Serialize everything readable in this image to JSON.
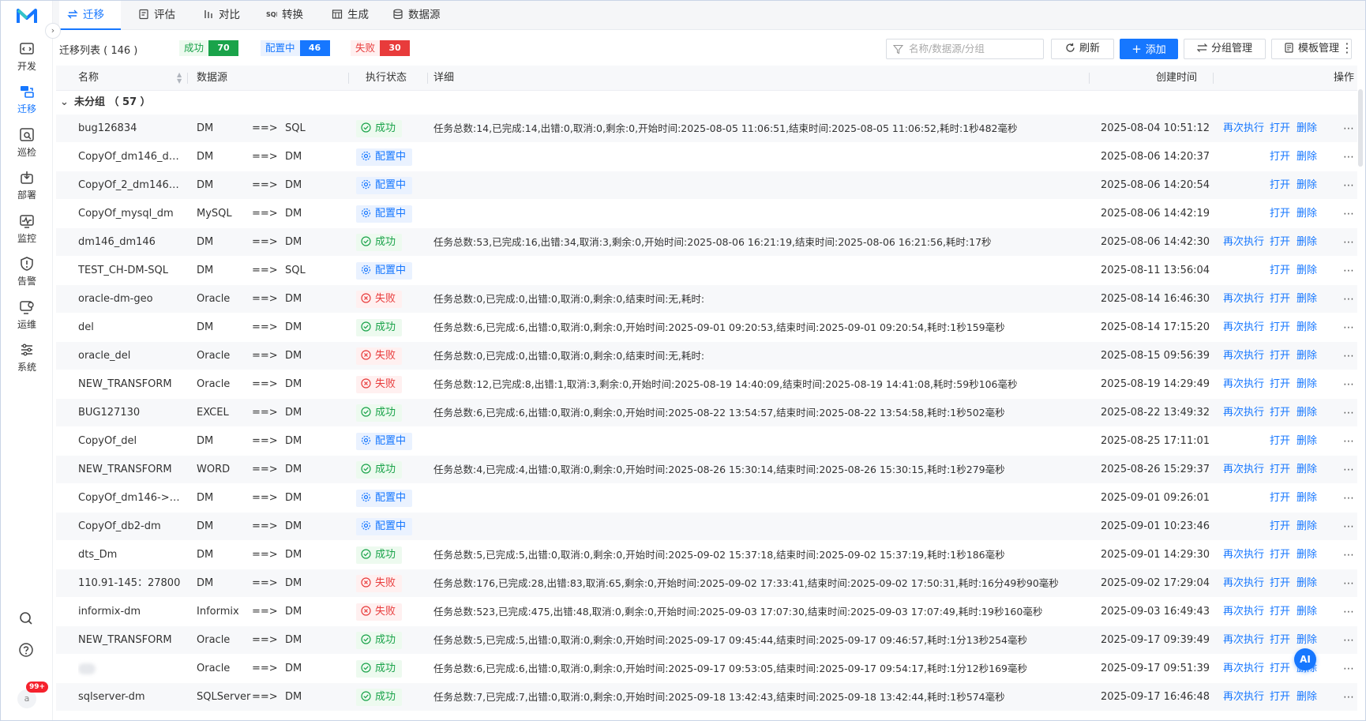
{
  "sidebar": {
    "items": [
      {
        "label": "开发",
        "icon": "code-icon"
      },
      {
        "label": "迁移",
        "icon": "migrate-icon"
      },
      {
        "label": "巡检",
        "icon": "inspect-icon"
      },
      {
        "label": "部署",
        "icon": "deploy-icon"
      },
      {
        "label": "监控",
        "icon": "monitor-icon"
      },
      {
        "label": "告警",
        "icon": "alert-icon"
      },
      {
        "label": "运维",
        "icon": "ops-icon"
      },
      {
        "label": "系统",
        "icon": "settings-icon"
      }
    ],
    "active_index": 1,
    "notification_count": "99+",
    "avatar_text": "a"
  },
  "tabs": [
    {
      "label": "迁移",
      "icon": "migrate-tab-icon"
    },
    {
      "label": "评估",
      "icon": "evaluate-tab-icon"
    },
    {
      "label": "对比",
      "icon": "compare-tab-icon"
    },
    {
      "label": "转换",
      "icon": "convert-tab-icon"
    },
    {
      "label": "生成",
      "icon": "generate-tab-icon"
    },
    {
      "label": "数据源",
      "icon": "datasource-tab-icon"
    }
  ],
  "toolbar": {
    "title": "迁移列表 ( 146 )",
    "stats": {
      "success_label": "成功",
      "success_count": "70",
      "config_label": "配置中",
      "config_count": "46",
      "fail_label": "失败",
      "fail_count": "30"
    },
    "search_placeholder": "名称/数据源/分组",
    "refresh_label": "刷新",
    "add_label": "添加",
    "group_manage_label": "分组管理",
    "template_manage_label": "模板管理"
  },
  "table": {
    "columns": {
      "name": "名称",
      "datasource": "数据源",
      "status": "执行状态",
      "detail": "详细",
      "created": "创建时间",
      "actions": "操作"
    },
    "group": "未分组 （ 57 ）",
    "rerun_label": "再次执行",
    "open_label": "打开",
    "delete_label": "删除",
    "rows": [
      {
        "name": "bug126834",
        "src": "DM",
        "dst": "SQL",
        "status": "成功",
        "kind": "ok",
        "detail": "任务总数:14,已完成:14,出错:0,取消:0,剩余:0,开始时间:2025-08-05 11:06:51,结束时间:2025-08-05 11:06:52,耗时:1秒482毫秒",
        "time": "2025-08-04 10:51:12",
        "rerun": true
      },
      {
        "name": "CopyOf_dm146_dm...",
        "src": "DM",
        "dst": "DM",
        "status": "配置中",
        "kind": "cfg",
        "detail": "",
        "time": "2025-08-06 14:20:37",
        "rerun": false
      },
      {
        "name": "CopyOf_2_dm146_d...",
        "src": "DM",
        "dst": "DM",
        "status": "配置中",
        "kind": "cfg",
        "detail": "",
        "time": "2025-08-06 14:20:54",
        "rerun": false
      },
      {
        "name": "CopyOf_mysql_dm",
        "src": "MySQL",
        "dst": "DM",
        "status": "配置中",
        "kind": "cfg",
        "detail": "",
        "time": "2025-08-06 14:42:19",
        "rerun": false
      },
      {
        "name": "dm146_dm146",
        "src": "DM",
        "dst": "DM",
        "status": "成功",
        "kind": "ok",
        "detail": "任务总数:53,已完成:16,出错:34,取消:3,剩余:0,开始时间:2025-08-06 16:21:19,结束时间:2025-08-06 16:21:56,耗时:17秒",
        "time": "2025-08-06 14:42:30",
        "rerun": true
      },
      {
        "name": "TEST_CH-DM-SQL",
        "src": "DM",
        "dst": "SQL",
        "status": "配置中",
        "kind": "cfg",
        "detail": "",
        "time": "2025-08-11 13:56:04",
        "rerun": false
      },
      {
        "name": "oracle-dm-geo",
        "src": "Oracle",
        "dst": "DM",
        "status": "失败",
        "kind": "fail",
        "detail": "任务总数:0,已完成:0,出错:0,取消:0,剩余:0,结束时间:无,耗时:",
        "time": "2025-08-14 16:46:30",
        "rerun": true
      },
      {
        "name": "del",
        "src": "DM",
        "dst": "DM",
        "status": "成功",
        "kind": "ok",
        "detail": "任务总数:6,已完成:6,出错:0,取消:0,剩余:0,开始时间:2025-09-01 09:20:53,结束时间:2025-09-01 09:20:54,耗时:1秒159毫秒",
        "time": "2025-08-14 17:15:20",
        "rerun": true
      },
      {
        "name": "oracle_del",
        "src": "Oracle",
        "dst": "DM",
        "status": "失败",
        "kind": "fail",
        "detail": "任务总数:0,已完成:0,出错:0,取消:0,剩余:0,结束时间:无,耗时:",
        "time": "2025-08-15 09:56:39",
        "rerun": true
      },
      {
        "name": "NEW_TRANSFORM",
        "src": "Oracle",
        "dst": "DM",
        "status": "失败",
        "kind": "fail",
        "detail": "任务总数:12,已完成:8,出错:1,取消:3,剩余:0,开始时间:2025-08-19 14:40:09,结束时间:2025-08-19 14:41:08,耗时:59秒106毫秒",
        "time": "2025-08-19 14:29:49",
        "rerun": true
      },
      {
        "name": "BUG127130",
        "src": "EXCEL",
        "dst": "DM",
        "status": "成功",
        "kind": "ok",
        "detail": "任务总数:6,已完成:6,出错:0,取消:0,剩余:0,开始时间:2025-08-22 13:54:57,结束时间:2025-08-22 13:54:58,耗时:1秒502毫秒",
        "time": "2025-08-22 13:49:32",
        "rerun": true
      },
      {
        "name": "CopyOf_del",
        "src": "DM",
        "dst": "DM",
        "status": "配置中",
        "kind": "cfg",
        "detail": "",
        "time": "2025-08-25 17:11:01",
        "rerun": false
      },
      {
        "name": "NEW_TRANSFORM",
        "src": "WORD",
        "dst": "DM",
        "status": "成功",
        "kind": "ok",
        "detail": "任务总数:4,已完成:4,出错:0,取消:0,剩余:0,开始时间:2025-08-26 15:30:14,结束时间:2025-08-26 15:30:15,耗时:1秒279毫秒",
        "time": "2025-08-26 15:29:37",
        "rerun": true
      },
      {
        "name": "CopyOf_dm146->d...",
        "src": "DM",
        "dst": "DM",
        "status": "配置中",
        "kind": "cfg",
        "detail": "",
        "time": "2025-09-01 09:26:01",
        "rerun": false
      },
      {
        "name": "CopyOf_db2-dm",
        "src": "DM",
        "dst": "DM",
        "status": "配置中",
        "kind": "cfg",
        "detail": "",
        "time": "2025-09-01 10:23:46",
        "rerun": false
      },
      {
        "name": "dts_Dm",
        "src": "DM",
        "dst": "DM",
        "status": "成功",
        "kind": "ok",
        "detail": "任务总数:5,已完成:5,出错:0,取消:0,剩余:0,开始时间:2025-09-02 15:37:18,结束时间:2025-09-02 15:37:19,耗时:1秒186毫秒",
        "time": "2025-09-01 14:29:30",
        "rerun": true
      },
      {
        "name": "110.91-145：27800",
        "src": "DM",
        "dst": "DM",
        "status": "失败",
        "kind": "fail",
        "detail": "任务总数:176,已完成:28,出错:83,取消:65,剩余:0,开始时间:2025-09-02 17:33:41,结束时间:2025-09-02 17:50:31,耗时:16分49秒90毫秒",
        "time": "2025-09-02 17:29:04",
        "rerun": true
      },
      {
        "name": "informix-dm",
        "src": "Informix",
        "dst": "DM",
        "status": "失败",
        "kind": "fail",
        "detail": "任务总数:523,已完成:475,出错:48,取消:0,剩余:0,开始时间:2025-09-03 17:07:30,结束时间:2025-09-03 17:07:49,耗时:19秒160毫秒",
        "time": "2025-09-03 16:49:43",
        "rerun": true
      },
      {
        "name": "NEW_TRANSFORM",
        "src": "Oracle",
        "dst": "DM",
        "status": "成功",
        "kind": "ok",
        "detail": "任务总数:5,已完成:5,出错:0,取消:0,剩余:0,开始时间:2025-09-17 09:45:44,结束时间:2025-09-17 09:46:57,耗时:1分13秒254毫秒",
        "time": "2025-09-17 09:39:49",
        "rerun": true
      },
      {
        "name": "",
        "src": "Oracle",
        "dst": "DM",
        "status": "成功",
        "kind": "ok",
        "detail": "任务总数:6,已完成:6,出错:0,取消:0,剩余:0,开始时间:2025-09-17 09:53:05,结束时间:2025-09-17 09:54:17,耗时:1分12秒169毫秒",
        "time": "2025-09-17 09:51:39",
        "rerun": true,
        "blurred": true
      },
      {
        "name": "sqlserver-dm",
        "src": "SQLServer",
        "dst": "DM",
        "status": "成功",
        "kind": "ok",
        "detail": "任务总数:7,已完成:7,出错:0,取消:0,剩余:0,开始时间:2025-09-18 13:42:43,结束时间:2025-09-18 13:42:44,耗时:1秒574毫秒",
        "time": "2025-09-17 16:46:48",
        "rerun": true
      }
    ]
  },
  "ai_button_label": "AI",
  "colors": {
    "accent": "#1677ff",
    "success": "#1aa34a",
    "fail": "#e83b3b"
  }
}
